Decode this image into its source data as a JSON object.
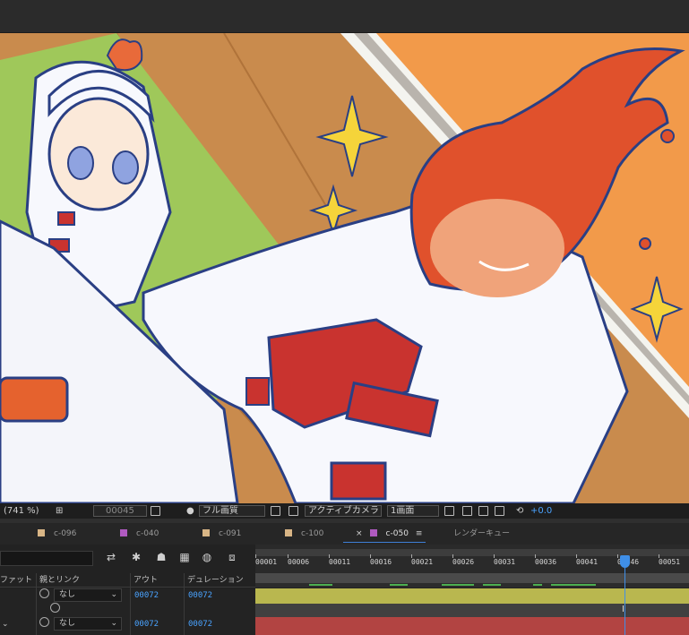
{
  "viewer": {
    "zoom": "(741 %)",
    "frame": "00045",
    "resolution": "フル画質",
    "camera": "アクティブカメラ",
    "views": "1画面",
    "exposure": "+0.0"
  },
  "tabs": [
    {
      "label": "c-096",
      "color": "#d8b585",
      "active": false
    },
    {
      "label": "c-040",
      "color": "#b05ac0",
      "active": false
    },
    {
      "label": "c-091",
      "color": "#d8b585",
      "active": false
    },
    {
      "label": "c-100",
      "color": "#d8b585",
      "active": false
    },
    {
      "label": "c-050",
      "color": "#b05ac0",
      "active": true
    },
    {
      "label": "レンダーキュー",
      "color": null,
      "active": false
    }
  ],
  "active_tab_close": "×",
  "active_tab_menu": "≡",
  "columns": {
    "mode": "ファット",
    "parent": "親とリンク",
    "out": "アウト",
    "duration": "デュレーション"
  },
  "layers": [
    {
      "parent": "なし",
      "out": "00072",
      "duration": "00072"
    },
    {
      "parent": "",
      "out": "",
      "duration": ""
    },
    {
      "parent": "なし",
      "out": "00072",
      "duration": "00072"
    }
  ],
  "ruler_ticks": [
    "00001",
    "00006",
    "00011",
    "00016",
    "00021",
    "00026",
    "00031",
    "00036",
    "00041",
    "00046",
    "00051"
  ],
  "playhead": {
    "frame": "00046"
  },
  "colors": {
    "track1": "#b9b74f",
    "track2": "#404040",
    "track3": "#b24442",
    "accent": "#3f8fe8"
  }
}
